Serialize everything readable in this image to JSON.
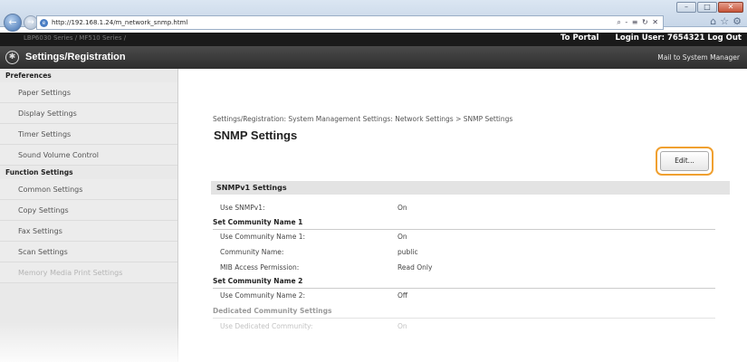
{
  "browser": {
    "url": "http://192.168.1.24/m_network_snmp.html",
    "url_tools": "⌕ - ≡ ↻ ✕",
    "window_buttons": [
      "–",
      "□",
      "✕"
    ]
  },
  "topbar": {
    "product": "LBP6030 Series / MF510 Series /",
    "to_portal": "To Portal",
    "login_user": "Login User:  7654321",
    "log_out": "Log Out"
  },
  "appbar": {
    "title": "Settings/Registration",
    "mail_link": "Mail to System Manager"
  },
  "sidebar": {
    "sections": [
      {
        "heading": "Preferences",
        "items": [
          "Paper Settings",
          "Display Settings",
          "Timer Settings",
          "Sound Volume Control"
        ]
      },
      {
        "heading": "Function Settings",
        "items": [
          "Common Settings",
          "Copy Settings",
          "Fax Settings",
          "Scan Settings",
          "Memory Media Print Settings"
        ]
      }
    ]
  },
  "main": {
    "breadcrumb": "Settings/Registration: System Management Settings: Network Settings > SNMP Settings",
    "title": "SNMP Settings",
    "edit_label": "Edit...",
    "section_title": "SNMPv1 Settings",
    "rows": [
      {
        "label": "Use SNMPv1:",
        "value": "On"
      },
      {
        "label": "Set Community Name 1",
        "value": ""
      },
      {
        "label": "Use Community Name 1:",
        "value": "On"
      },
      {
        "label": "Community Name:",
        "value": "public"
      },
      {
        "label": "MIB Access Permission:",
        "value": "Read Only"
      },
      {
        "label": "Set Community Name 2",
        "value": ""
      },
      {
        "label": "Use Community Name 2:",
        "value": "Off"
      },
      {
        "label": "Dedicated Community Settings",
        "value": ""
      },
      {
        "label": "Use Dedicated Community:",
        "value": "On"
      }
    ]
  }
}
